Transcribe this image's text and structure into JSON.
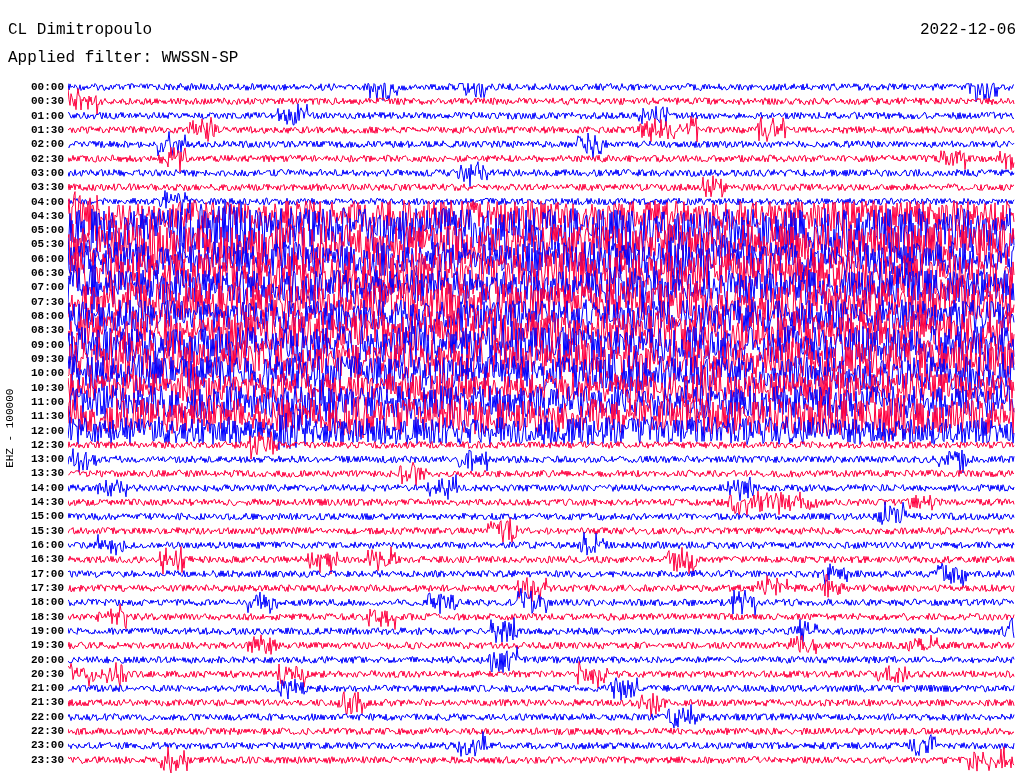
{
  "header": {
    "station": "CL Dimitropoulo",
    "filter": "Applied filter: WWSSN-SP",
    "date": "2022-12-06"
  },
  "y_axis_label": "EHZ - 100000",
  "rows": [
    {
      "time": "00:00",
      "color": "#0000ff"
    },
    {
      "time": "00:30",
      "color": "#ff0040"
    },
    {
      "time": "01:00",
      "color": "#0000ff"
    },
    {
      "time": "01:30",
      "color": "#ff0040"
    },
    {
      "time": "02:00",
      "color": "#0000ff"
    },
    {
      "time": "02:30",
      "color": "#ff0040"
    },
    {
      "time": "03:00",
      "color": "#0000ff"
    },
    {
      "time": "03:30",
      "color": "#ff0040"
    },
    {
      "time": "04:00",
      "color": "#0000ff"
    },
    {
      "time": "04:30",
      "color": "#ff0040"
    },
    {
      "time": "05:00",
      "color": "#0000ff"
    },
    {
      "time": "05:30",
      "color": "#ff0040"
    },
    {
      "time": "06:00",
      "color": "#0000ff"
    },
    {
      "time": "06:30",
      "color": "#ff0040"
    },
    {
      "time": "07:00",
      "color": "#0000ff"
    },
    {
      "time": "07:30",
      "color": "#ff0040"
    },
    {
      "time": "08:00",
      "color": "#0000ff"
    },
    {
      "time": "08:30",
      "color": "#ff0040"
    },
    {
      "time": "09:00",
      "color": "#0000ff"
    },
    {
      "time": "09:30",
      "color": "#ff0040"
    },
    {
      "time": "10:00",
      "color": "#0000ff"
    },
    {
      "time": "10:30",
      "color": "#ff0040"
    },
    {
      "time": "11:00",
      "color": "#0000ff"
    },
    {
      "time": "11:30",
      "color": "#ff0040"
    },
    {
      "time": "12:00",
      "color": "#0000ff"
    },
    {
      "time": "12:30",
      "color": "#ff0040"
    },
    {
      "time": "13:00",
      "color": "#0000ff"
    },
    {
      "time": "13:30",
      "color": "#ff0040"
    },
    {
      "time": "14:00",
      "color": "#0000ff"
    },
    {
      "time": "14:30",
      "color": "#ff0040"
    },
    {
      "time": "15:00",
      "color": "#0000ff"
    },
    {
      "time": "15:30",
      "color": "#ff0040"
    },
    {
      "time": "16:00",
      "color": "#0000ff"
    },
    {
      "time": "16:30",
      "color": "#ff0040"
    },
    {
      "time": "17:00",
      "color": "#0000ff"
    },
    {
      "time": "17:30",
      "color": "#ff0040"
    },
    {
      "time": "18:00",
      "color": "#0000ff"
    },
    {
      "time": "18:30",
      "color": "#ff0040"
    },
    {
      "time": "19:00",
      "color": "#0000ff"
    },
    {
      "time": "19:30",
      "color": "#ff0040"
    },
    {
      "time": "20:00",
      "color": "#0000ff"
    },
    {
      "time": "20:30",
      "color": "#ff0040"
    },
    {
      "time": "21:00",
      "color": "#0000ff"
    },
    {
      "time": "21:30",
      "color": "#ff0040"
    },
    {
      "time": "22:00",
      "color": "#0000ff"
    },
    {
      "time": "22:30",
      "color": "#ff0040"
    },
    {
      "time": "23:00",
      "color": "#0000ff"
    },
    {
      "time": "23:30",
      "color": "#ff0040"
    }
  ]
}
